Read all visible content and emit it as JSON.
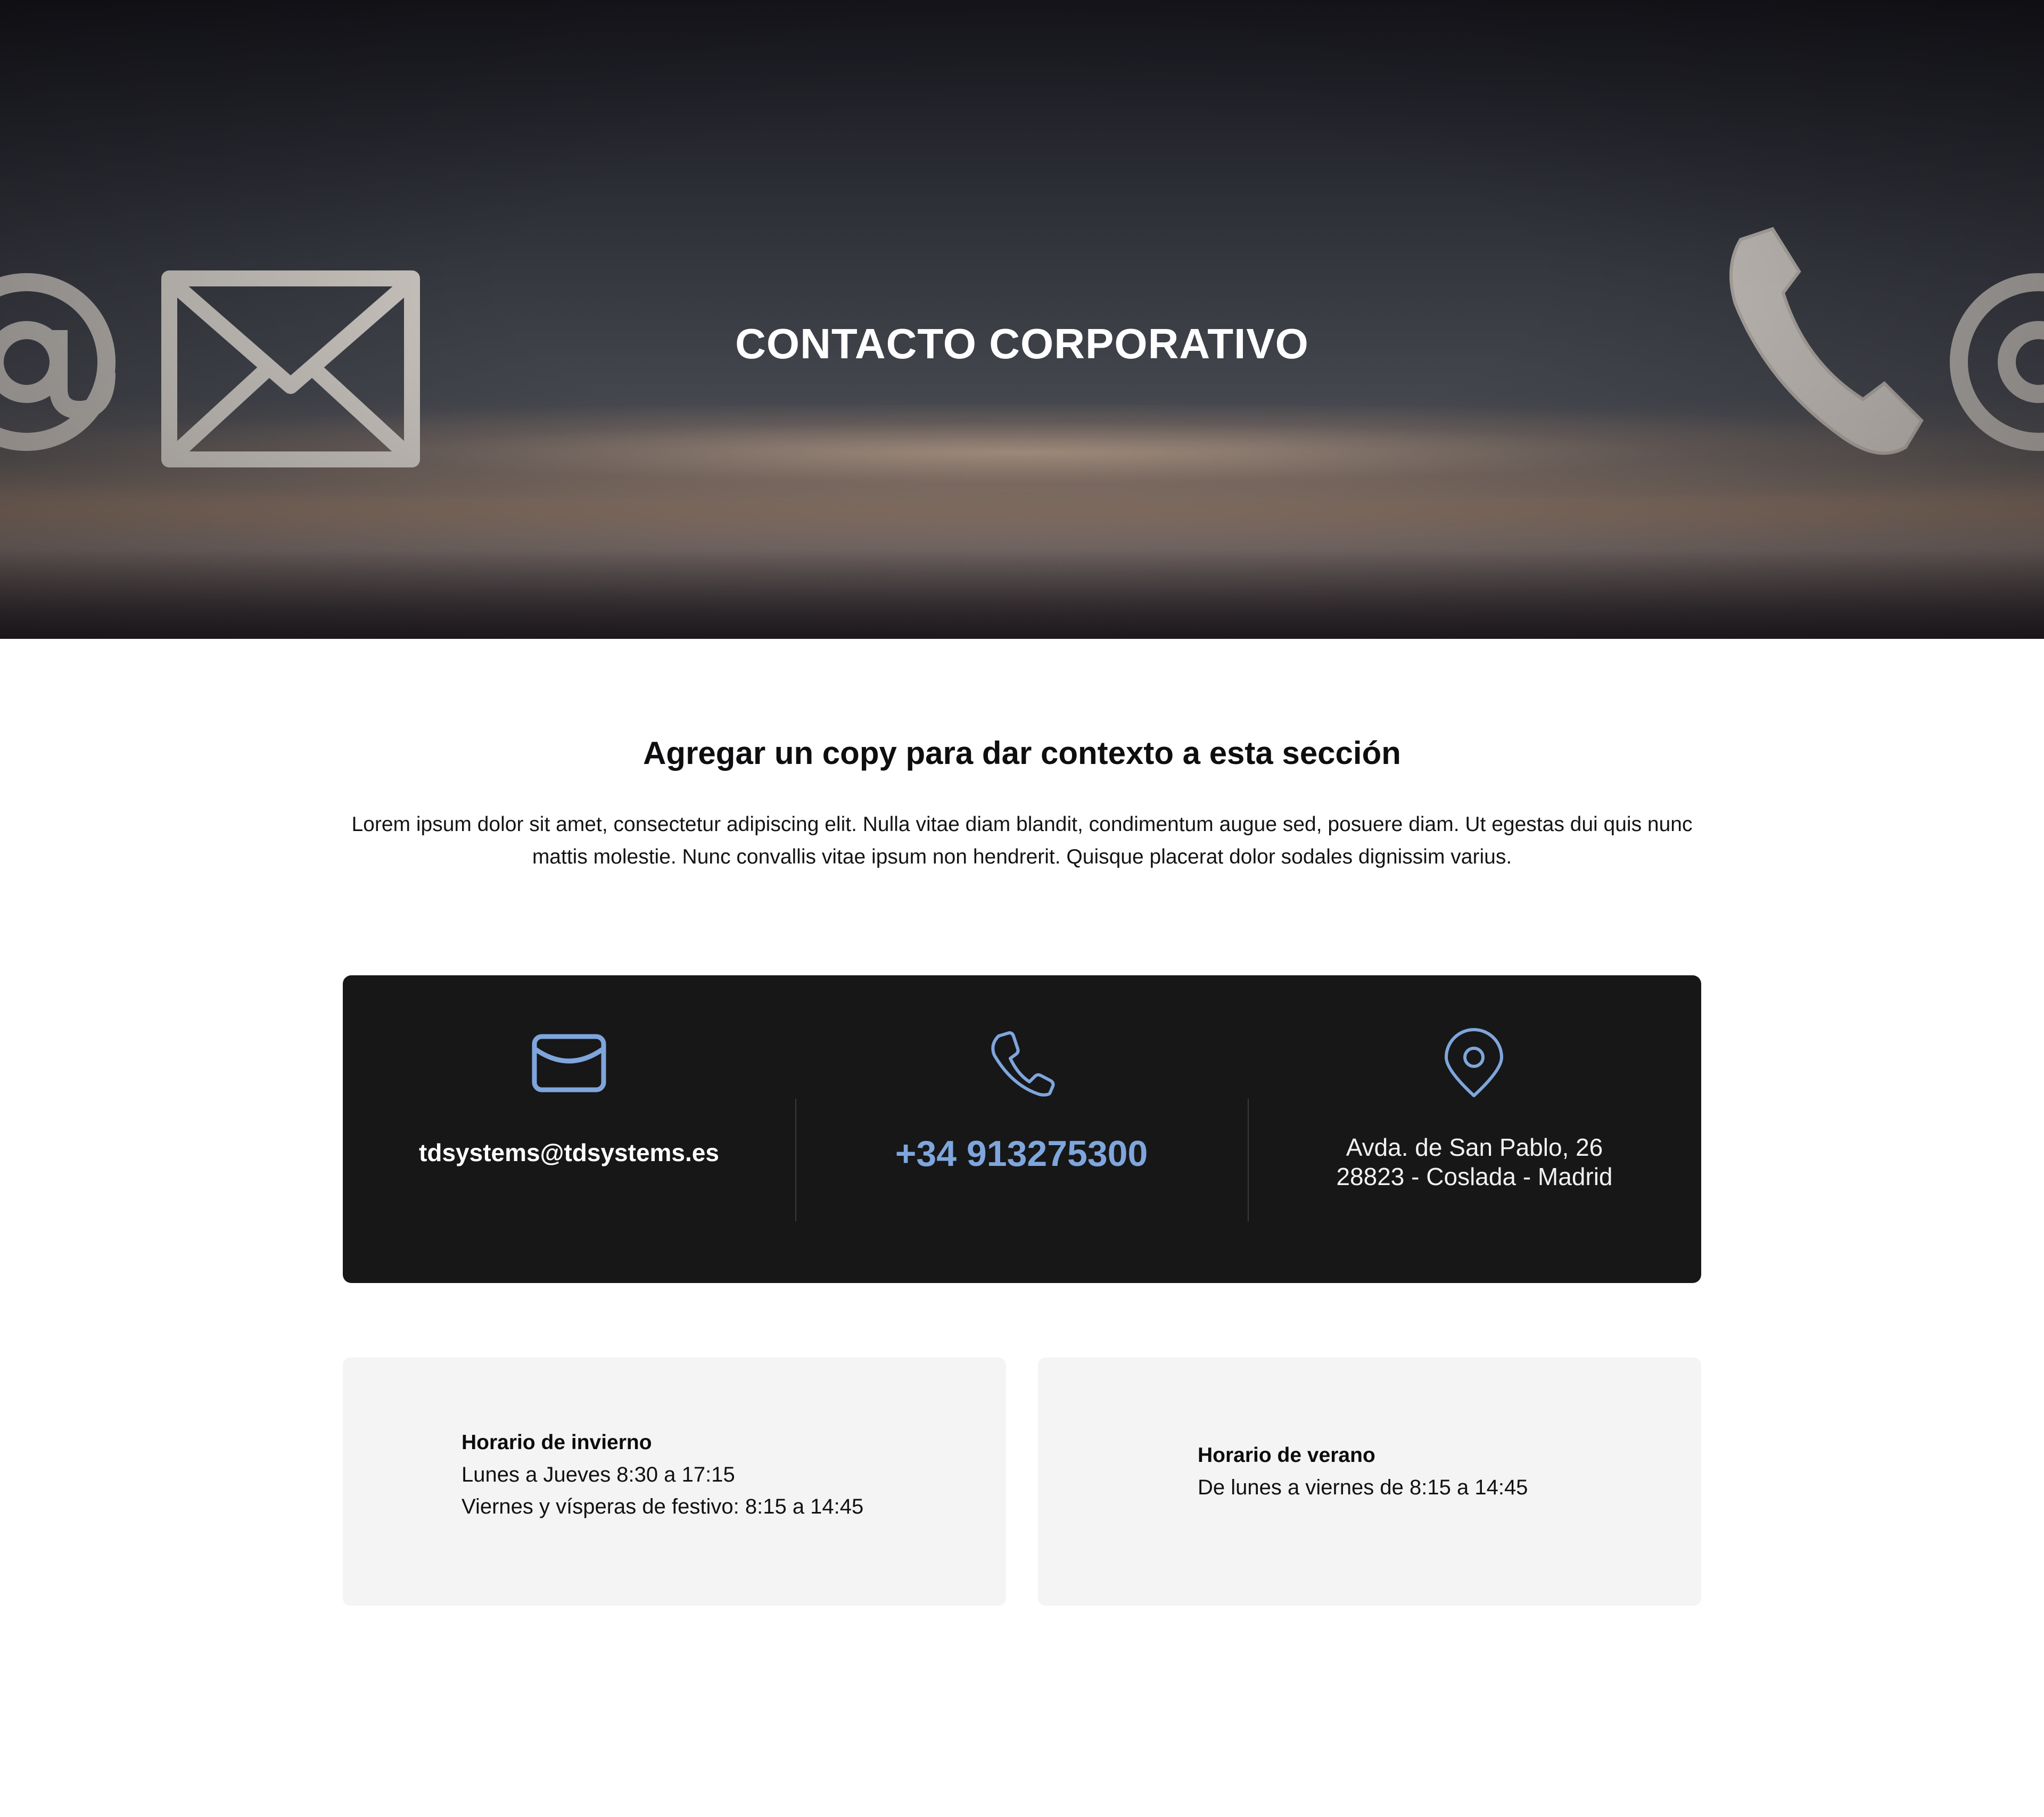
{
  "hero": {
    "title": "CONTACTO CORPORATIVO"
  },
  "intro": {
    "heading": "Agregar un copy para dar contexto a esta sección",
    "text": "Lorem ipsum dolor sit amet, consectetur adipiscing elit. Nulla vitae diam blandit, condimentum augue sed, posuere diam. Ut egestas dui quis nunc mattis molestie. Nunc convallis vitae ipsum non hendrerit. Quisque placerat dolor sodales dignissim varius."
  },
  "contact": {
    "email": {
      "icon": "envelope-icon",
      "value": "tdsystems@tdsystems.es"
    },
    "phone": {
      "icon": "phone-icon",
      "value": "+34 913275300"
    },
    "address": {
      "icon": "map-pin-icon",
      "line1": "Avda. de San Pablo, 26",
      "line2": "28823 - Coslada -  Madrid"
    },
    "colors": {
      "card_background": "#171718",
      "accent": "#7fa6dc"
    }
  },
  "schedules": [
    {
      "title": "Horario de invierno",
      "lines": [
        "Lunes a Jueves 8:30 a 17:15",
        "Viernes y vísperas de festivo: 8:15 a 14:45"
      ]
    },
    {
      "title": "Horario de verano",
      "lines": [
        "De lunes a viernes de 8:15 a 14:45"
      ]
    }
  ]
}
